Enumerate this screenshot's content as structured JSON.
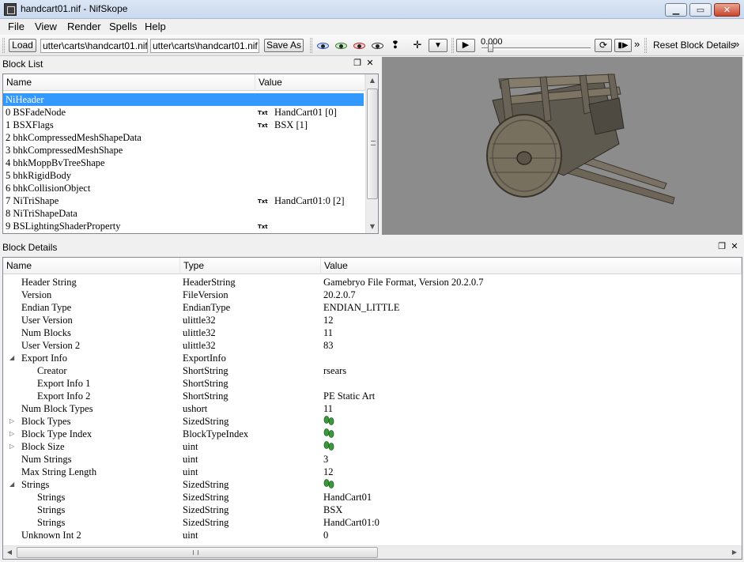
{
  "window": {
    "title": "handcart01.nif - NifSkope",
    "controls": [
      "minimize",
      "maximize",
      "close"
    ]
  },
  "menu": [
    "File",
    "View",
    "Render",
    "Spells",
    "Help"
  ],
  "toolbar": {
    "load_label": "Load",
    "load_path": "utter\\carts\\handcart01.nif",
    "save_path": "utter\\carts\\handcart01.nif",
    "save_as_label": "Save As",
    "time_value": "0.000",
    "reset_label": "Reset Block Details",
    "overflow": "»"
  },
  "block_list": {
    "title": "Block List",
    "columns": [
      "Name",
      "Value"
    ],
    "rows": [
      {
        "name": "NiHeader",
        "tag": "",
        "value": "",
        "selected": true
      },
      {
        "name": "0 BSFadeNode",
        "tag": "Txt",
        "value": "HandCart01 [0]"
      },
      {
        "name": "1 BSXFlags",
        "tag": "Txt",
        "value": "BSX [1]"
      },
      {
        "name": "2 bhkCompressedMeshShapeData",
        "tag": "",
        "value": ""
      },
      {
        "name": "3 bhkCompressedMeshShape",
        "tag": "",
        "value": ""
      },
      {
        "name": "4 bhkMoppBvTreeShape",
        "tag": "",
        "value": ""
      },
      {
        "name": "5 bhkRigidBody",
        "tag": "",
        "value": ""
      },
      {
        "name": "6 bhkCollisionObject",
        "tag": "",
        "value": ""
      },
      {
        "name": "7 NiTriShape",
        "tag": "Txt",
        "value": "HandCart01:0 [2]"
      },
      {
        "name": "8 NiTriShapeData",
        "tag": "",
        "value": ""
      },
      {
        "name": "9 BSLightingShaderProperty",
        "tag": "Txt",
        "value": ""
      }
    ]
  },
  "block_details": {
    "title": "Block Details",
    "columns": [
      "Name",
      "Type",
      "Value"
    ],
    "rows": [
      {
        "name": "Header String",
        "type": "HeaderString",
        "value": "Gamebryo File Format, Version 20.2.0.7",
        "indent": 0,
        "expander": "",
        "icon": false
      },
      {
        "name": "Version",
        "type": "FileVersion",
        "value": "20.2.0.7",
        "indent": 0,
        "expander": "",
        "icon": false
      },
      {
        "name": "Endian Type",
        "type": "EndianType",
        "value": "ENDIAN_LITTLE",
        "indent": 0,
        "expander": "",
        "icon": false
      },
      {
        "name": "User Version",
        "type": "ulittle32",
        "value": "12",
        "indent": 0,
        "expander": "",
        "icon": false
      },
      {
        "name": "Num Blocks",
        "type": "ulittle32",
        "value": "11",
        "indent": 0,
        "expander": "",
        "icon": false
      },
      {
        "name": "User Version 2",
        "type": "ulittle32",
        "value": "83",
        "indent": 0,
        "expander": "",
        "icon": false
      },
      {
        "name": "Export Info",
        "type": "ExportInfo",
        "value": "",
        "indent": 0,
        "expander": "open",
        "icon": false
      },
      {
        "name": "Creator",
        "type": "ShortString",
        "value": "rsears",
        "indent": 1,
        "expander": "",
        "icon": false
      },
      {
        "name": "Export Info 1",
        "type": "ShortString",
        "value": "",
        "indent": 1,
        "expander": "",
        "icon": false
      },
      {
        "name": "Export Info 2",
        "type": "ShortString",
        "value": " PE Static Art",
        "indent": 1,
        "expander": "",
        "icon": false
      },
      {
        "name": "Num Block Types",
        "type": "ushort",
        "value": "11",
        "indent": 0,
        "expander": "",
        "icon": false
      },
      {
        "name": "Block Types",
        "type": "SizedString",
        "value": "",
        "indent": 0,
        "expander": "closed",
        "icon": true
      },
      {
        "name": "Block Type Index",
        "type": "BlockTypeIndex",
        "value": "",
        "indent": 0,
        "expander": "closed",
        "icon": true
      },
      {
        "name": "Block Size",
        "type": "uint",
        "value": "",
        "indent": 0,
        "expander": "closed",
        "icon": true
      },
      {
        "name": "Num Strings",
        "type": "uint",
        "value": "3",
        "indent": 0,
        "expander": "",
        "icon": false
      },
      {
        "name": "Max String Length",
        "type": "uint",
        "value": "12",
        "indent": 0,
        "expander": "",
        "icon": false
      },
      {
        "name": "Strings",
        "type": "SizedString",
        "value": "",
        "indent": 0,
        "expander": "open",
        "icon": true
      },
      {
        "name": "Strings",
        "type": "SizedString",
        "value": "HandCart01",
        "indent": 1,
        "expander": "",
        "icon": false
      },
      {
        "name": "Strings",
        "type": "SizedString",
        "value": "BSX",
        "indent": 1,
        "expander": "",
        "icon": false
      },
      {
        "name": "Strings",
        "type": "SizedString",
        "value": "HandCart01:0",
        "indent": 1,
        "expander": "",
        "icon": false
      },
      {
        "name": "Unknown Int 2",
        "type": "uint",
        "value": "0",
        "indent": 0,
        "expander": "",
        "icon": false
      }
    ]
  },
  "colors": {
    "selection": "#3399ff",
    "viewport_bg": "#8c8c8c"
  }
}
